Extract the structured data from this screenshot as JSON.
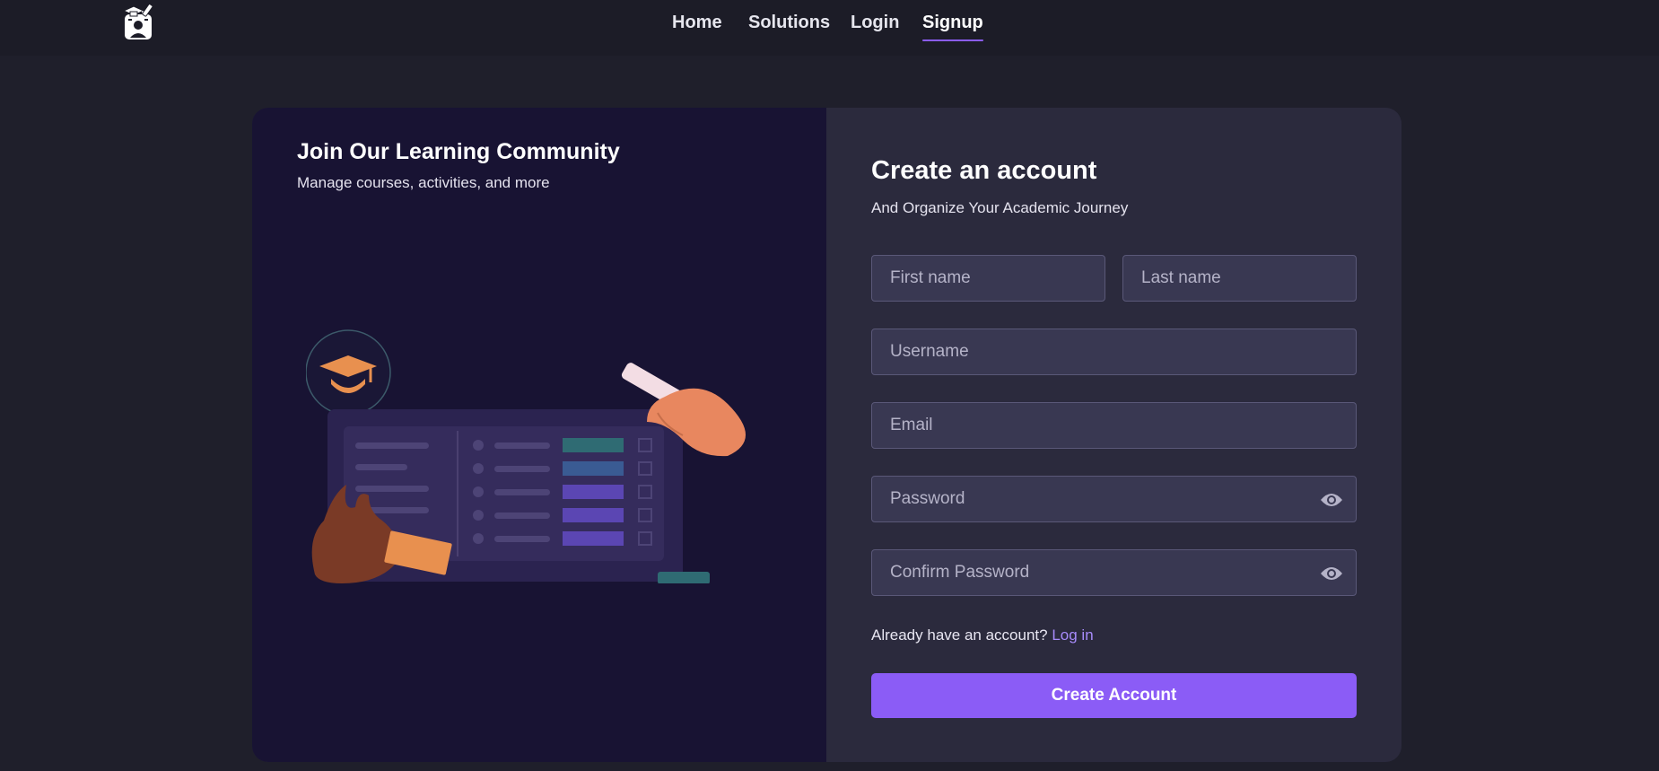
{
  "header": {
    "logo_icon": "student-graduation-cap-logo",
    "nav": [
      {
        "label": "Home",
        "active": false
      },
      {
        "label": "Solutions",
        "active": false
      },
      {
        "label": "Login",
        "active": false
      },
      {
        "label": "Signup",
        "active": true
      }
    ]
  },
  "promo": {
    "title": "Join Our Learning Community",
    "subtitle": "Manage courses, activities, and more",
    "illustration": "hands-dashboard-illustration"
  },
  "form": {
    "title": "Create an account",
    "subtitle": "And Organize Your Academic Journey",
    "fields": {
      "first_name": {
        "placeholder": "First name",
        "value": ""
      },
      "last_name": {
        "placeholder": "Last name",
        "value": ""
      },
      "username": {
        "placeholder": "Username",
        "value": ""
      },
      "email": {
        "placeholder": "Email",
        "value": ""
      },
      "password": {
        "placeholder": "Password",
        "value": "",
        "toggle_icon": "eye-icon"
      },
      "confirm_password": {
        "placeholder": "Confirm Password",
        "value": "",
        "toggle_icon": "eye-icon"
      }
    },
    "login_prompt": "Already have an account?",
    "login_link": "Log in",
    "submit_label": "Create Account"
  },
  "colors": {
    "accent": "#8b5cf6",
    "link": "#a78bfa",
    "page_bg": "#1f1f2b",
    "panel_left": "#181333",
    "panel_right": "#2b2a3d",
    "input_bg": "#393852"
  }
}
